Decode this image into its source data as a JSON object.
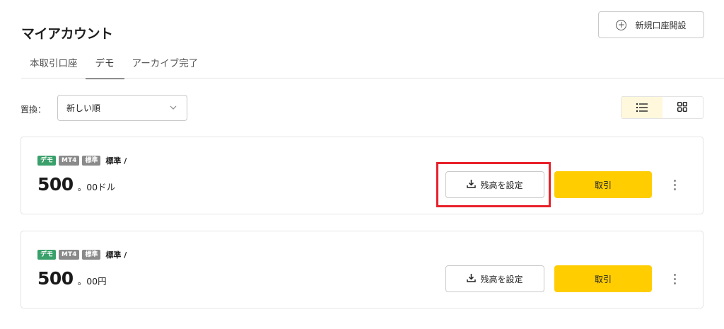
{
  "header": {
    "title": "マイアカウント",
    "new_account_label": "新規口座開設"
  },
  "tabs": [
    {
      "label": "本取引口座",
      "active": false
    },
    {
      "label": "デモ",
      "active": true
    },
    {
      "label": "アーカイブ完了",
      "active": false
    }
  ],
  "sort": {
    "label": "置換：",
    "value": "新しい順"
  },
  "view_toggle": {
    "active": "list-view"
  },
  "accounts": [
    {
      "badges": [
        "デモ",
        "MT4",
        "標準"
      ],
      "type": "標準 /",
      "balance_int": "500",
      "balance_dec": "。00ドル",
      "set_balance_label": "残高を設定",
      "trade_label": "取引",
      "highlighted": true
    },
    {
      "badges": [
        "デモ",
        "MT4",
        "標準"
      ],
      "type": "標準 /",
      "balance_int": "500",
      "balance_dec": "。00円",
      "set_balance_label": "残高を設定",
      "trade_label": "取引",
      "highlighted": false
    }
  ],
  "colors": {
    "trade_button": "#ffcd00",
    "demo_badge": "#3aa06b",
    "gray_badge": "#8a8a8a",
    "highlight": "#e8202a",
    "view_active_bg": "#fff8dc"
  }
}
